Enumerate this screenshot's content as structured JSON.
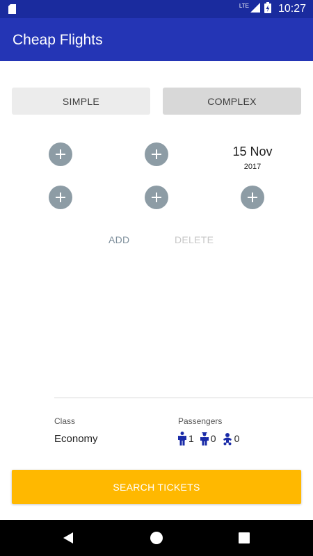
{
  "status_bar": {
    "time": "10:27",
    "network_label": "LTE",
    "icons": [
      "sd-card-icon",
      "signal-icon",
      "battery-charging-icon"
    ]
  },
  "app_bar": {
    "title": "Cheap Flights"
  },
  "mode_tabs": {
    "simple_label": "SIMPLE",
    "complex_label": "COMPLEX",
    "selected": "COMPLEX"
  },
  "route": {
    "add_icon": "add-circle-icon",
    "date": {
      "day": "15 Nov",
      "year": "2017"
    }
  },
  "actions": {
    "add_label": "ADD",
    "delete_label": "DELETE"
  },
  "trip": {
    "class_label": "Class",
    "class_value": "Economy",
    "passengers_label": "Passengers",
    "passengers": [
      {
        "icon": "adult-icon",
        "count": "1"
      },
      {
        "icon": "child-icon",
        "count": "0"
      },
      {
        "icon": "infant-icon",
        "count": "0"
      }
    ]
  },
  "search_button": {
    "label": "SEARCH TICKETS"
  },
  "nav_bar": {
    "icons": [
      "back-icon",
      "home-icon",
      "recents-icon"
    ]
  },
  "colors": {
    "status_bar": "#1a2b9e",
    "app_bar": "#2435b5",
    "accent": "#ffb800",
    "circle_button": "#8d9ca5",
    "passenger_icon": "#1a2ba8"
  }
}
